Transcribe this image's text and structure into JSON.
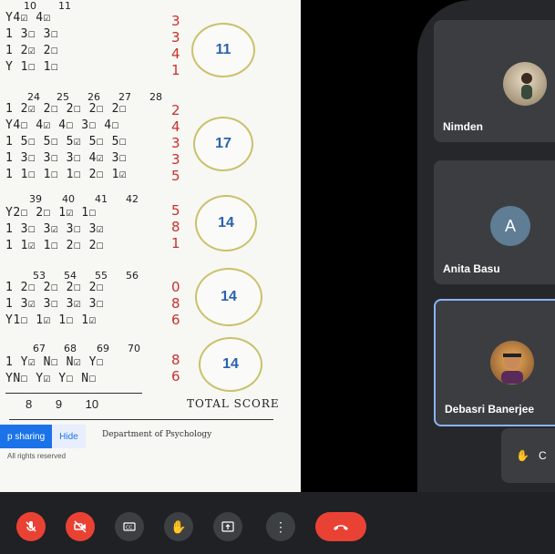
{
  "document": {
    "scores": [
      "11",
      "17",
      "14",
      "14",
      "14"
    ],
    "question_numbers": {
      "row1": [
        "10",
        "11"
      ],
      "row2": [
        "24",
        "25",
        "26",
        "27",
        "28"
      ],
      "row3": [
        "39",
        "40",
        "41",
        "42"
      ],
      "row4": [
        "53",
        "54",
        "55",
        "56"
      ],
      "row5": [
        "67",
        "68",
        "69",
        "70"
      ]
    },
    "red_marks": {
      "block1": [
        "3",
        "3",
        "4",
        "1"
      ],
      "block2": [
        "2",
        "4",
        "3",
        "3",
        "5"
      ],
      "block3": [
        "5",
        "8",
        "1"
      ],
      "block4": [
        "0",
        "8",
        "6"
      ],
      "block5": [
        "8",
        "6"
      ]
    },
    "scale_numbers": "8 9 10",
    "total_score_label": "TOTAL SCORE",
    "department": "Department of Psychology",
    "rights_text": "All rights reserved"
  },
  "sharing_bar": {
    "stop_label": "p sharing",
    "hide_label": "Hide"
  },
  "participants": [
    {
      "name": "Nimden",
      "avatar": "photo"
    },
    {
      "name": "Anita Basu",
      "avatar_letter": "A"
    },
    {
      "name": "Debasri Banerjee",
      "avatar": "photo",
      "active": true
    }
  ],
  "raise_hand_chip": {
    "label": "C",
    "icon": "hand-icon"
  },
  "controls": [
    {
      "name": "mic-off",
      "icon": "mic-off-icon"
    },
    {
      "name": "camera-off",
      "icon": "camera-off-icon"
    },
    {
      "name": "captions",
      "icon": "cc-icon"
    },
    {
      "name": "raise-hand",
      "icon": "hand-icon"
    },
    {
      "name": "present",
      "icon": "present-icon"
    },
    {
      "name": "more",
      "icon": "more-vert-icon"
    },
    {
      "name": "end-call",
      "icon": "end-call-icon"
    }
  ],
  "colors": {
    "accent_blue": "#1a73e8",
    "end_red": "#e94235",
    "score_blue": "#2a62b0",
    "mark_red": "#c8322c"
  }
}
